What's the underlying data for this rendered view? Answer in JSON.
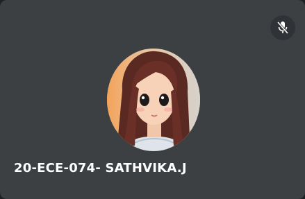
{
  "participant": {
    "name": "20-ECE-074- SATHVIKA.J",
    "avatar_icon": "avatar-image",
    "mic_status": "muted",
    "mic_icon": "mic-off-icon"
  },
  "colors": {
    "tile_background": "#3c4043",
    "mic_button_background": "#2f3236",
    "name_text": "#ffffff"
  }
}
